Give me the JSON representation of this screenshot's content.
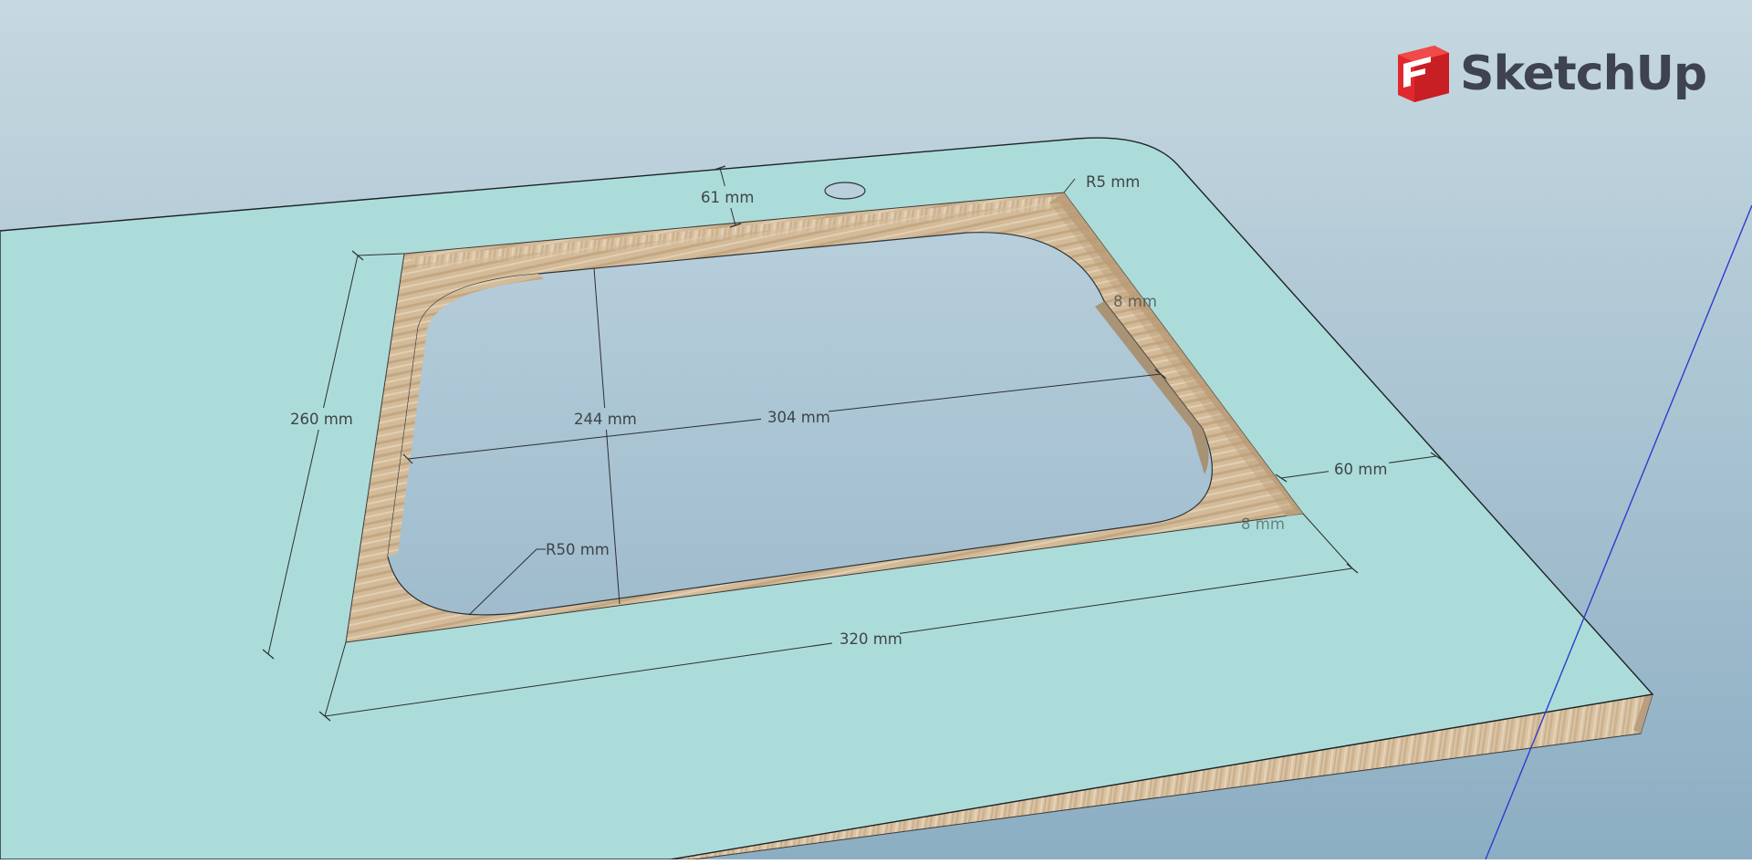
{
  "app": {
    "brand_name": "SketchUp",
    "logo_icon": "sketchup-logo-icon",
    "brand_color": "#e0292f"
  },
  "viewport": {
    "sky_top_color": "#c4d6df",
    "sky_bottom_color": "#8fb2c6",
    "surface_color": "#acdcd9",
    "wood_color": "#d8c2a4",
    "axis_color": "#2f3bd0"
  },
  "dimensions": {
    "total_width": "320 mm",
    "total_depth": "260 mm",
    "inner_width": "304 mm",
    "inner_depth": "244 mm",
    "back_offset": "61 mm",
    "side_offset": "60 mm",
    "corner_radius_large": "R50 mm",
    "corner_radius_small": "R5 mm",
    "partial_right": "8 mm",
    "partial_bottom": "8 mm"
  }
}
